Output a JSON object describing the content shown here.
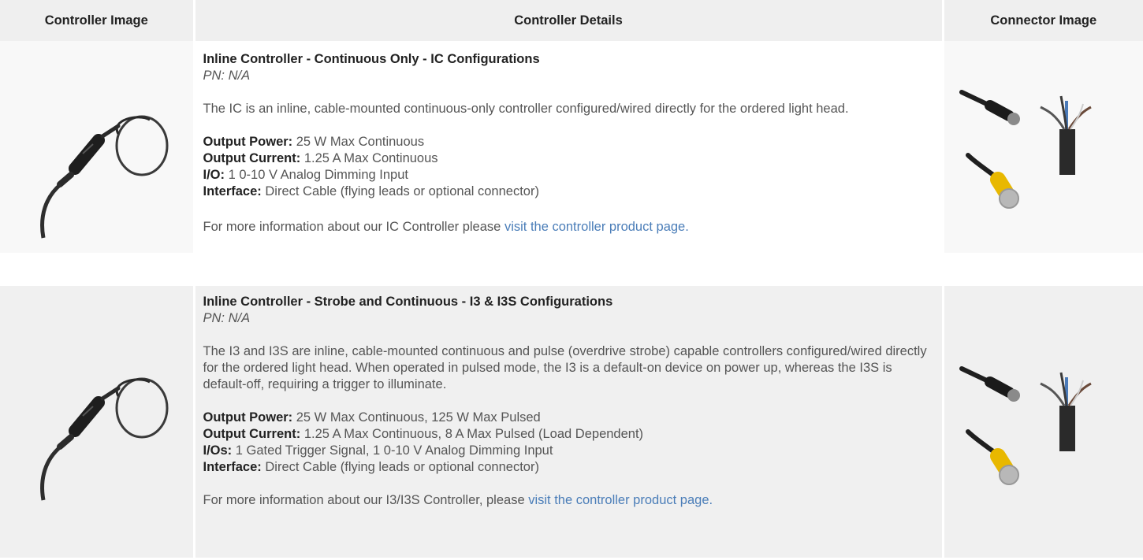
{
  "table": {
    "headers": [
      "Controller Image",
      "Controller Details",
      "Connector Image"
    ],
    "rows": [
      {
        "title": "Inline Controller - Continuous Only - IC Configurations",
        "pn": "PN: N/A",
        "description": "The IC is an inline, cable-mounted continuous-only controller configured/wired directly for the ordered light head.",
        "specs": [
          {
            "label": "Output Power:",
            "value": "25 W Max Continuous"
          },
          {
            "label": "Output Current:",
            "value": "1.25 A Max Continuous"
          },
          {
            "label": "I/O:",
            "value": "1 0-10 V Analog Dimming Input"
          },
          {
            "label": "Interface:",
            "value": "Direct Cable (flying leads or optional connector)"
          }
        ],
        "more_text": "For more information about our IC Controller please ",
        "link_text": "visit the controller product page."
      },
      {
        "title": "Inline Controller - Strobe and Continuous - I3 & I3S Configurations",
        "pn": "PN: N/A",
        "description": "The I3 and I3S are inline, cable-mounted continuous and pulse (overdrive strobe) capable controllers configured/wired directly for the ordered light head. When operated in pulsed mode, the I3 is a default-on device on power up, whereas the I3S is default-off, requiring a trigger to illuminate.",
        "specs": [
          {
            "label": "Output Power:",
            "value": "25 W Max Continuous, 125 W Max Pulsed"
          },
          {
            "label": "Output Current:",
            "value": "1.25 A Max Continuous, 8 A Max Pulsed (Load Dependent)"
          },
          {
            "label": "I/Os:",
            "value": "1 Gated Trigger Signal, 1 0-10 V Analog Dimming Input"
          },
          {
            "label": "Interface:",
            "value": "Direct Cable (flying leads or optional connector)"
          }
        ],
        "more_text": "For more information about our I3/I3S Controller, please ",
        "link_text": "visit the controller product page."
      }
    ]
  },
  "colors": {
    "link": "#4a7db8",
    "header_bg": "#efefef",
    "row_alt_bg": "#f0f0f0",
    "connector_yellow": "#e8b800"
  },
  "icons": [
    "inline-controller-image",
    "connector-image"
  ]
}
